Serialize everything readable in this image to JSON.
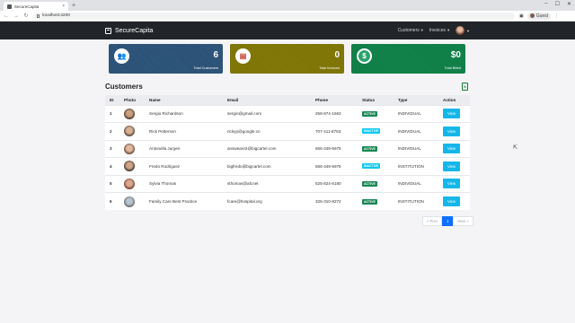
{
  "browser": {
    "tab_title": "SecureCapita",
    "tab_close": "×",
    "new_tab": "+",
    "url": "localhost:4200",
    "profile_label": "Guest",
    "win_controls": [
      "–",
      "☐",
      "✕"
    ]
  },
  "navbar": {
    "brand": "SecureCapita",
    "links": [
      "Customers",
      "Invoices"
    ]
  },
  "stats": [
    {
      "value": "6",
      "label": "Total Customers",
      "icon": "users-icon",
      "color": "#2a4e73"
    },
    {
      "value": "0",
      "label": "Total Invoices",
      "icon": "invoice-icon",
      "color": "#7a7105"
    },
    {
      "value": "$0",
      "label": "Total Billed",
      "icon": "dollar-icon",
      "color": "#0f7a45"
    }
  ],
  "customers": {
    "title": "Customers",
    "columns": [
      "ID",
      "Photo",
      "Name",
      "Email",
      "Phone",
      "Status",
      "Type",
      "Action"
    ],
    "rows": [
      {
        "id": "1",
        "name": "Sergio Richardson",
        "email": "sergio@gmail.com",
        "phone": "258-974-1563",
        "status": "ACTIVE",
        "type": "INDIVIDUAL",
        "action": "View"
      },
      {
        "id": "2",
        "name": "Rick Petterson",
        "email": "rickyp@google.cn",
        "phone": "707-411-8753",
        "status": "INACTIVE",
        "type": "INDIVIDUAL",
        "action": "View"
      },
      {
        "id": "3",
        "name": "Antonella Jurgen",
        "email": "answeare2@bigcartel.com",
        "phone": "556-349-5975",
        "status": "ACTIVE",
        "type": "INDIVIDUAL",
        "action": "View"
      },
      {
        "id": "4",
        "name": "Fredo Rodriguez",
        "email": "bigfredo@bigcartel.com",
        "phone": "556-349-5975",
        "status": "INACTIVE",
        "type": "INSTITUTION",
        "action": "View"
      },
      {
        "id": "5",
        "name": "Sylvia Thomas",
        "email": "sthomas@alt.net",
        "phone": "525-824-6180",
        "status": "ACTIVE",
        "type": "INDIVIDUAL",
        "action": "View"
      },
      {
        "id": "6",
        "name": "Family Care Best Practice",
        "email": "fcare@hospital.org",
        "phone": "325-310-8272",
        "status": "ACTIVE",
        "type": "INSTITUTION",
        "action": "View"
      }
    ]
  },
  "pagination": {
    "prev": "« Prev",
    "current": "1",
    "next": "Next »"
  },
  "colors": {
    "active": "#198754",
    "inactive": "#0dcaf0",
    "view": "#15b7e8"
  }
}
